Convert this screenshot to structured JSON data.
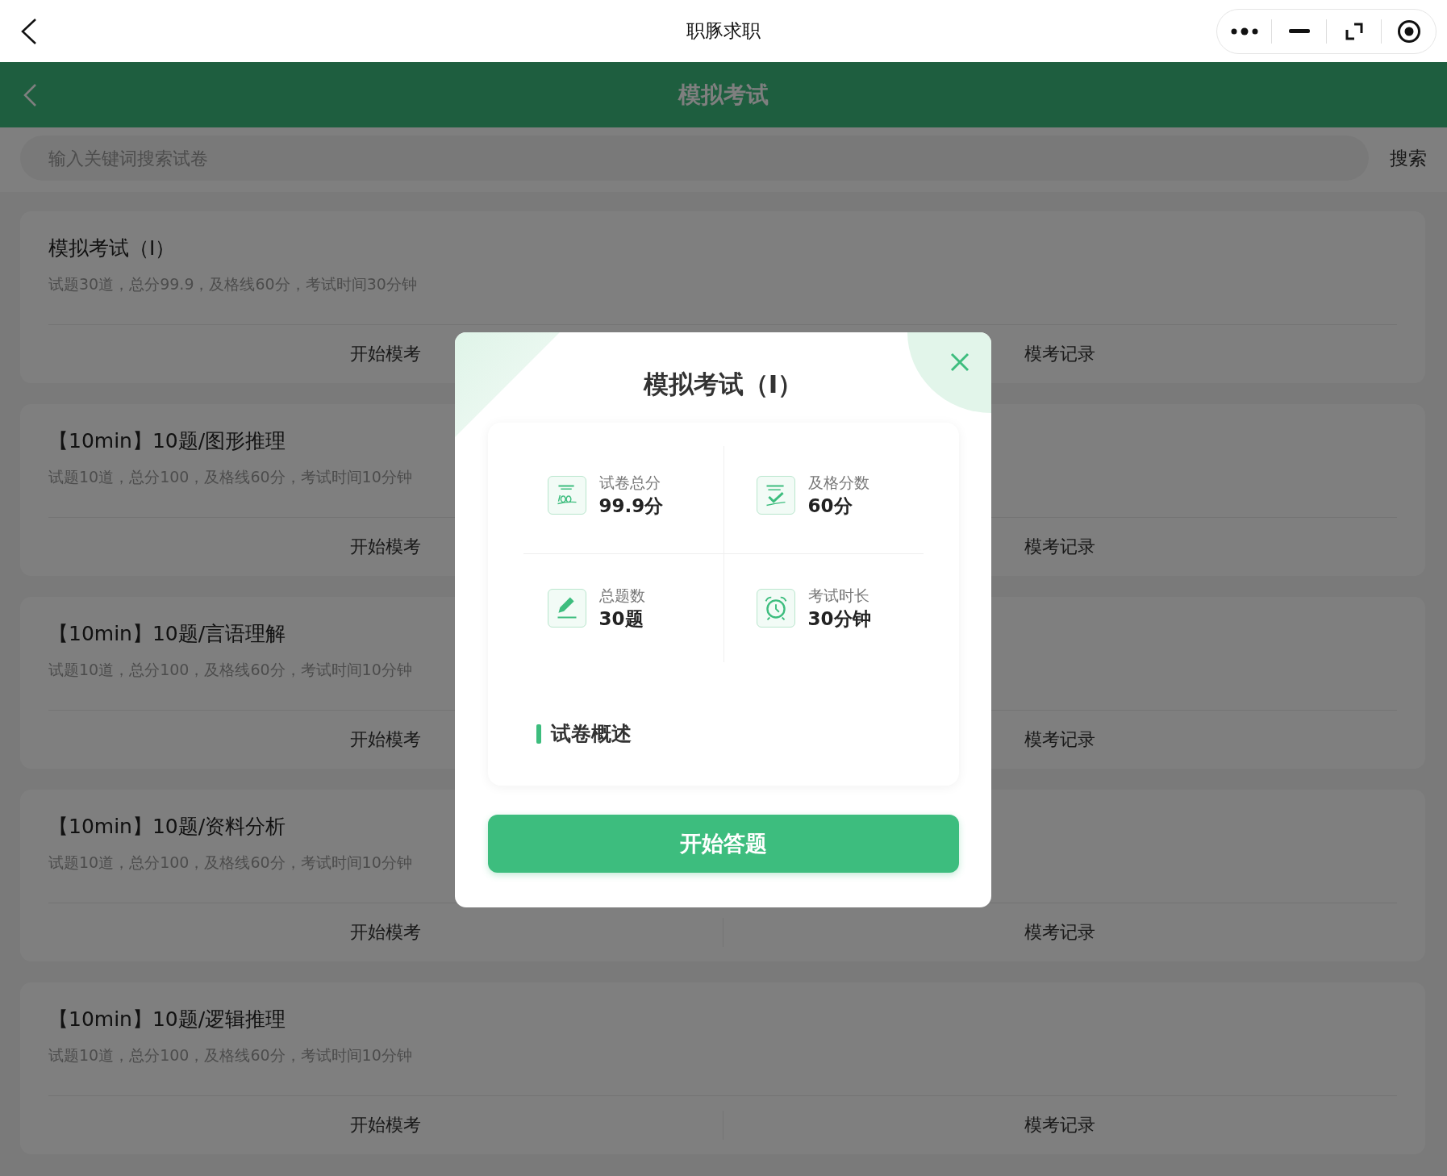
{
  "nav_bar": {
    "title": "职豚求职"
  },
  "header": {
    "title": "模拟考试"
  },
  "search": {
    "placeholder": "输入关键词搜索试卷",
    "button": "搜索"
  },
  "exams": [
    {
      "title": "模拟考试（I）",
      "desc": "试题30道，总分99.9，及格线60分，考试时间30分钟",
      "actions": [
        "开始模考",
        "模考记录"
      ]
    },
    {
      "title": "【10min】10题/图形推理",
      "desc": "试题10道，总分100，及格线60分，考试时间10分钟",
      "actions": [
        "开始模考",
        "模考记录"
      ]
    },
    {
      "title": "【10min】10题/言语理解",
      "desc": "试题10道，总分100，及格线60分，考试时间10分钟",
      "actions": [
        "开始模考",
        "模考记录"
      ]
    },
    {
      "title": "【10min】10题/资料分析",
      "desc": "试题10道，总分100，及格线60分，考试时间10分钟",
      "actions": [
        "开始模考",
        "模考记录"
      ]
    },
    {
      "title": "【10min】10题/逻辑推理",
      "desc": "试题10道，总分100，及格线60分，考试时间10分钟",
      "actions": [
        "开始模考",
        "模考记录"
      ]
    }
  ],
  "modal": {
    "title": "模拟考试（I）",
    "stats": [
      {
        "kind": "score",
        "label": "试卷总分",
        "value": "99.9分"
      },
      {
        "kind": "pass",
        "label": "及格分数",
        "value": "60分"
      },
      {
        "kind": "count",
        "label": "总题数",
        "value": "30题"
      },
      {
        "kind": "time",
        "label": "考试时长",
        "value": "30分钟"
      }
    ],
    "section_title": "试卷概述",
    "start_button": "开始答题"
  }
}
